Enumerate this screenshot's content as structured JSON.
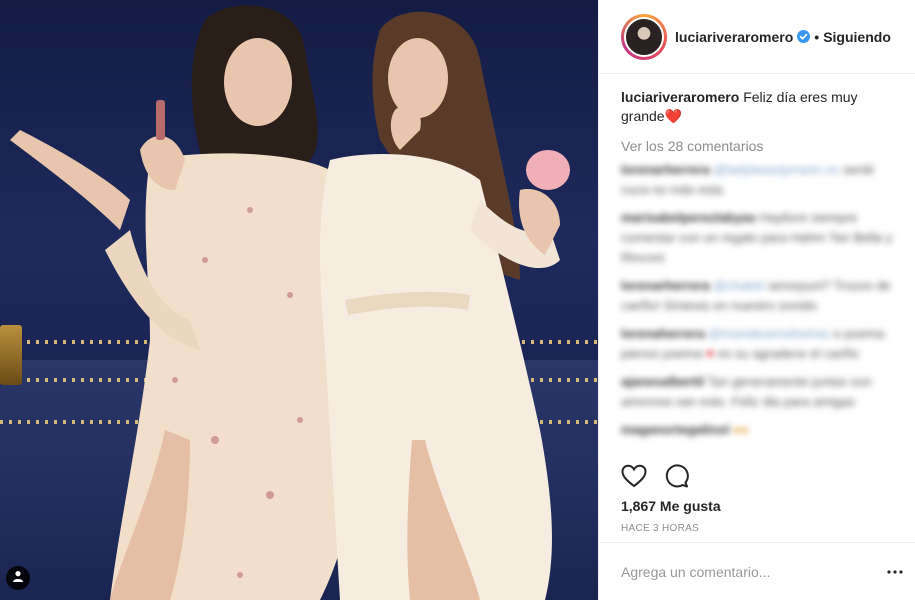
{
  "post": {
    "username": "luciariveraromero",
    "follow_status": "Siguiendo",
    "separator": "•",
    "caption_text": "Feliz día eres muy grande❤️",
    "view_comments": "Ver los 28 comentarios",
    "likes": "1,867 Me gusta",
    "timestamp": "HACE 3 HORAS",
    "add_comment_placeholder": "Agrega un comentario...",
    "more_options": "•••"
  },
  "blurred_comments": [
    {
      "user": "lorenarherrera",
      "text": "@ladybeautymarin es",
      "rest": "sentir cuca no más esta"
    },
    {
      "user": "marisabelperezlabyas",
      "text": "Hayliore siempre",
      "rest": "comentar con un regalo para Hahm Tan Bella y Rinconi"
    },
    {
      "user": "lorenarherrera",
      "text": "@chabel",
      "rest": "amorpuni? Trozos de cariño! Síntesis en nuestro sonido"
    },
    {
      "user": "lorenaherrera",
      "text": "@mariabuensilveiras",
      "rest": "o poema pienso poema",
      "heart": "♥",
      "rest2": "es su agradece el cariño"
    },
    {
      "user": "ajanesalbertil",
      "text": "Tan generamente juntas son",
      "rest": "amorosa van esto. Feliz dia para amigas"
    },
    {
      "user": "maganortegalinol",
      "text": "",
      "emoji": "●●"
    }
  ],
  "colors": {
    "accent_blue": "#3897f0",
    "text": "#262626",
    "muted": "#8e8e8e",
    "border": "#efefef"
  },
  "icons": [
    "user-tag-icon",
    "verified-badge-icon",
    "heart-icon",
    "comment-icon",
    "more-options-icon"
  ]
}
